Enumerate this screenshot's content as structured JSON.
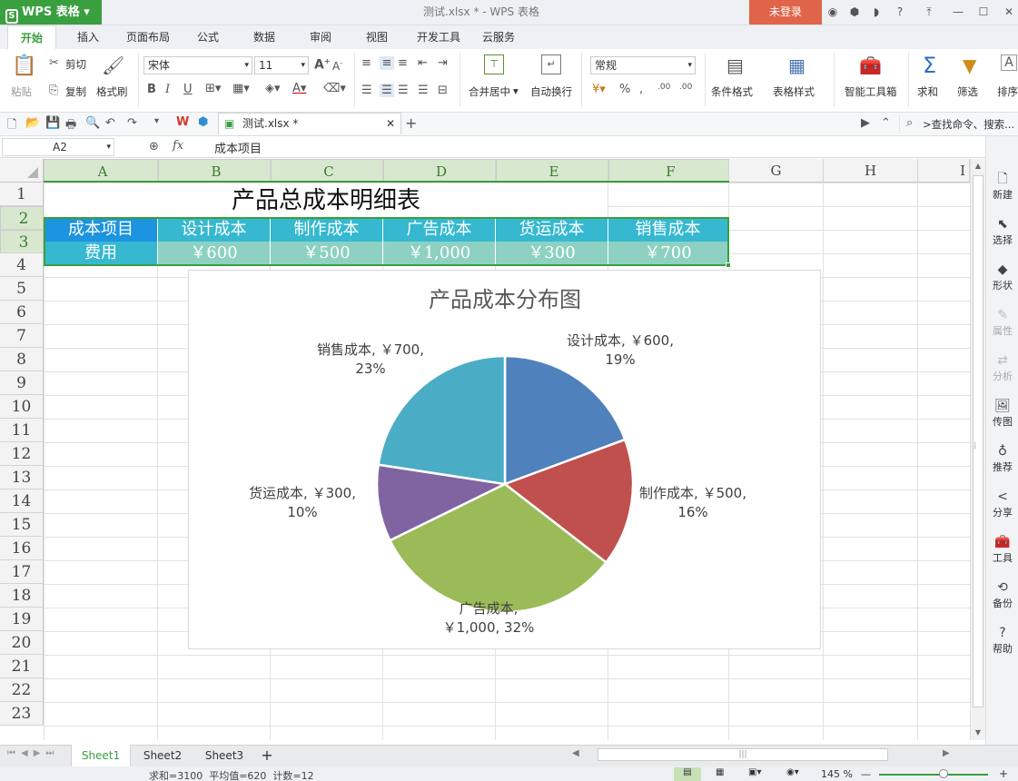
{
  "app": {
    "name": "WPS 表格",
    "doc_title": "测试.xlsx * - WPS 表格",
    "login": "未登录",
    "logo": "S"
  },
  "tabs": [
    "开始",
    "插入",
    "页面布局",
    "公式",
    "数据",
    "审阅",
    "视图",
    "开发工具",
    "云服务"
  ],
  "ribbon": {
    "paste": "粘贴",
    "cut": "剪切",
    "copy": "复制",
    "format_painter": "格式刷",
    "font_name": "宋体",
    "font_size": "11",
    "merge_center": "合并居中",
    "wrap_text": "自动换行",
    "number_format": "常规",
    "cond_format": "条件格式",
    "table_style": "表格样式",
    "smart_tools": "智能工具箱",
    "sum": "求和",
    "filter": "筛选",
    "sort": "排序"
  },
  "quickbar": {
    "file_tab": "测试.xlsx *",
    "search": ">查找命令、搜索..."
  },
  "formula": {
    "cell_ref": "A2",
    "fx": "fx",
    "content": "成本项目"
  },
  "columns": [
    "A",
    "B",
    "C",
    "D",
    "E",
    "F",
    "G",
    "H",
    "I"
  ],
  "rows": [
    "1",
    "2",
    "3",
    "4",
    "5",
    "6",
    "7",
    "8",
    "9",
    "10",
    "11",
    "12",
    "13",
    "14",
    "15",
    "16",
    "17",
    "18",
    "19",
    "20",
    "21",
    "22",
    "23"
  ],
  "sheet": {
    "title": "产品总成本明细表",
    "header_row": [
      "成本项目",
      "设计成本",
      "制作成本",
      "广告成本",
      "货运成本",
      "销售成本"
    ],
    "value_row": [
      "费用",
      "￥600",
      "￥500",
      "￥1,000",
      "￥300",
      "￥700"
    ]
  },
  "chart_data": {
    "type": "pie",
    "title": "产品成本分布图",
    "categories": [
      "设计成本",
      "制作成本",
      "广告成本",
      "货运成本",
      "销售成本"
    ],
    "values": [
      600,
      500,
      1000,
      300,
      700
    ],
    "colors": [
      "#4f81bd",
      "#c0504d",
      "#9bbb59",
      "#8064a2",
      "#4bacc6"
    ],
    "data_labels": [
      [
        "设计成本, ￥600,",
        "19%"
      ],
      [
        "制作成本, ￥500,",
        "16%"
      ],
      [
        "广告成本,",
        "￥1,000, 32%"
      ],
      [
        "货运成本, ￥300,",
        "10%"
      ],
      [
        "销售成本, ￥700,",
        "23%"
      ]
    ]
  },
  "right_panel": [
    "新建",
    "选择",
    "形状",
    "属性",
    "分析",
    "传图",
    "推荐",
    "分享",
    "工具",
    "备份",
    "帮助"
  ],
  "sheet_tabs": [
    "Sheet1",
    "Sheet2",
    "Sheet3"
  ],
  "status": {
    "summary": "求和=3100  平均值=620  计数=12",
    "zoom": "145 %"
  }
}
